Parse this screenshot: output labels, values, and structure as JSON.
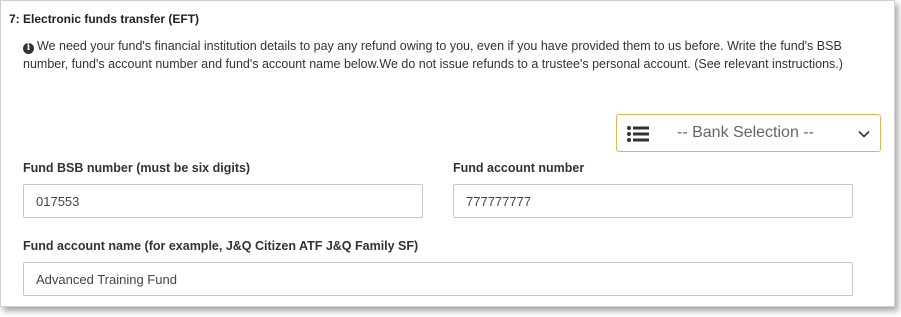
{
  "section": {
    "title": "7: Electronic funds transfer (EFT)",
    "info_text": "We need your fund's financial institution details to pay any refund owing to you, even if you have provided them to us before. Write the fund's BSB number, fund's account number and fund's account name below.We do not issue refunds to a trustee's personal account. (See relevant instructions.)"
  },
  "bank_selection": {
    "label": "-- Bank Selection --",
    "icon": "list-icon",
    "accent_color": "#e0b64d"
  },
  "fields": {
    "bsb": {
      "label": "Fund BSB number (must be six digits)",
      "value": "017553"
    },
    "account_number": {
      "label": "Fund account number",
      "value": "777777777"
    },
    "account_name": {
      "label": "Fund account name (for example, J&Q Citizen ATF J&Q Family SF)",
      "value": "Advanced Training Fund"
    }
  }
}
